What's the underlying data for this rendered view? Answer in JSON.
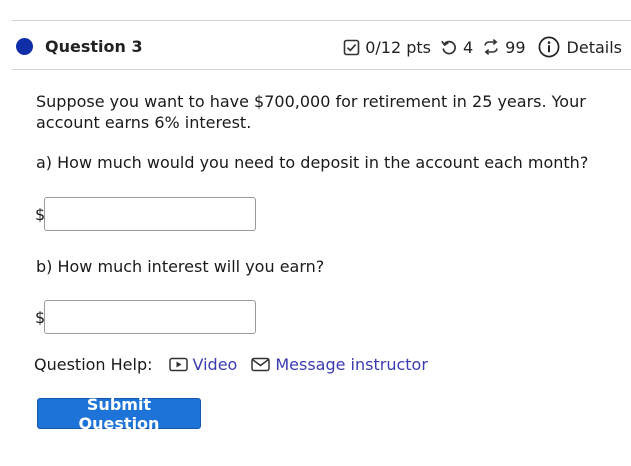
{
  "question": {
    "title": "Question 3",
    "score": "0/12 pts",
    "attempts": "4",
    "versions": "99",
    "details_label": "Details",
    "prompt": "Suppose you want to have $700,000 for retirement in 25 years. Your account earns 6% interest."
  },
  "parts": [
    {
      "text": "a) How much would you need to deposit in the account each month?",
      "prefix": "$",
      "value": ""
    },
    {
      "text": "b) How much interest will you earn?",
      "prefix": "$",
      "value": ""
    }
  ],
  "help": {
    "label": "Question Help:",
    "video_label": "Video",
    "message_label": "Message instructor"
  },
  "submit_label": "Submit Question",
  "colors": {
    "question_dot": "#0f2ea8",
    "link": "#3b3bb3",
    "button": "#1e73d8"
  }
}
